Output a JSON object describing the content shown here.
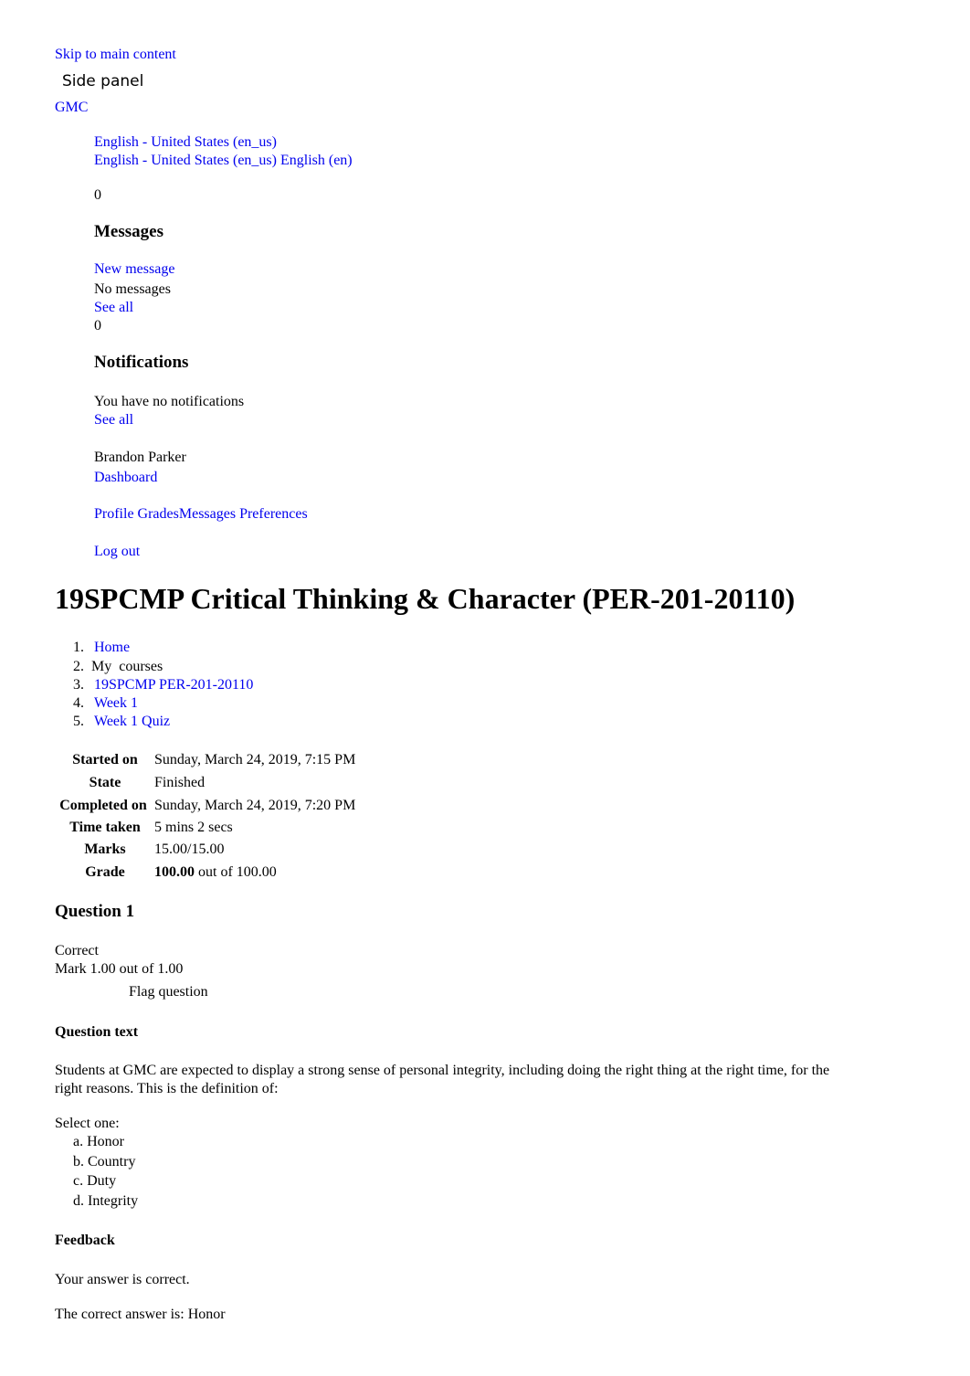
{
  "skip_link": "Skip to main content",
  "side_panel_label": "Side panel",
  "site_name": "GMC",
  "language": {
    "current": "English - United States (en_us)",
    "options": [
      "English - United States (en_us)",
      "English (en)"
    ]
  },
  "messages": {
    "count": "0",
    "heading": "Messages",
    "new_message": "New message",
    "empty_text": "No messages",
    "see_all": "See all"
  },
  "notifications": {
    "count": "0",
    "heading": "Notifications",
    "empty_text": "You have no notifications",
    "see_all": "See all"
  },
  "user_menu": {
    "user_name": "Brandon Parker",
    "dashboard": "Dashboard",
    "links": [
      "Profile",
      "Grades",
      "Messages",
      "Preferences"
    ],
    "logout": "Log out"
  },
  "page_title": "19SPCMP Critical Thinking & Character (PER-201-20110)",
  "breadcrumb": [
    {
      "num": "1.",
      "label": "Home",
      "link": true
    },
    {
      "num": "2.",
      "label": "My courses",
      "link": false
    },
    {
      "num": "3.",
      "label": "19SPCMP PER-201-20110",
      "link": true
    },
    {
      "num": "4.",
      "label": "Week 1",
      "link": true
    },
    {
      "num": "5.",
      "label": "Week 1 Quiz",
      "link": true
    }
  ],
  "summary": {
    "started_on": {
      "label": "Started on",
      "value": "Sunday, March 24, 2019, 7:15 PM"
    },
    "state": {
      "label": "State",
      "value": "Finished"
    },
    "completed_on": {
      "label": "Completed on",
      "value": "Sunday, March 24, 2019, 7:20 PM"
    },
    "time_taken": {
      "label": "Time taken",
      "value": "5 mins 2 secs"
    },
    "marks": {
      "label": "Marks",
      "value": "15.00/15.00"
    },
    "grade": {
      "label": "Grade",
      "value_bold": "100.00",
      "value_rest": "out of 100.00"
    }
  },
  "question": {
    "heading": "Question 1",
    "status": "Correct",
    "mark": "Mark 1.00 out of 1.00",
    "flag": "Flag question",
    "text_heading": "Question text",
    "text_line1": "Students at GMC are expected to display a strong sense of personal integrity, including doing the right thing at the right time, for the",
    "text_line2": "right reasons. This is the definition of:",
    "select_prompt": "Select one:",
    "answers": [
      "a. Honor",
      "b. Country",
      "c. Duty",
      "d. Integrity"
    ],
    "feedback_heading": "Feedback",
    "feedback_result": "Your answer is correct.",
    "correct_answer": "The correct answer is: Honor"
  }
}
